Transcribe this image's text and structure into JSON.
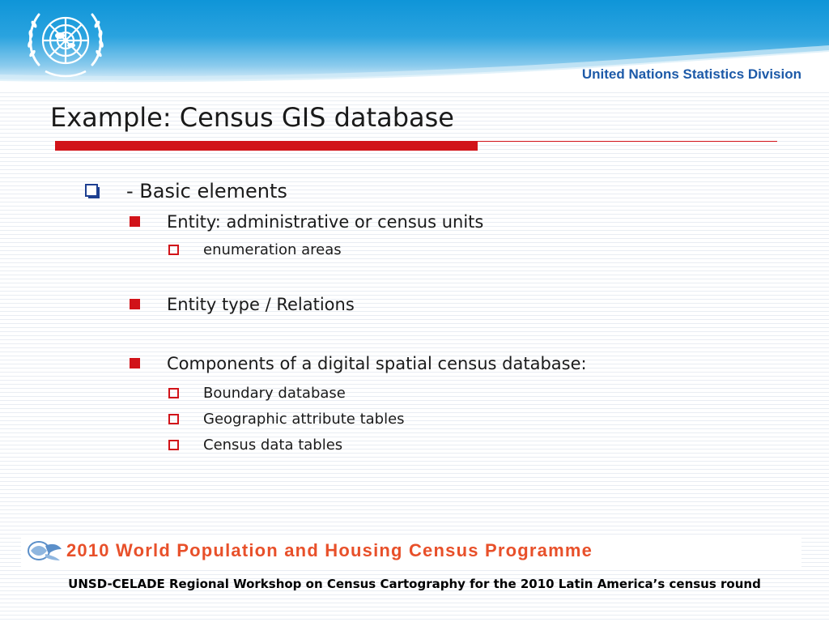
{
  "header": {
    "org_name": "United Nations Statistics Division"
  },
  "slide": {
    "title": "Example: Census GIS database",
    "items": [
      {
        "level": 1,
        "text": "- Basic elements"
      },
      {
        "level": 2,
        "text": "Entity: administrative or census units"
      },
      {
        "level": 3,
        "text": "enumeration areas"
      },
      {
        "level": 2,
        "text": "Entity type / Relations"
      },
      {
        "level": 2,
        "text": "Components of a digital spatial census database:"
      },
      {
        "level": 3,
        "text": "Boundary database"
      },
      {
        "level": 3,
        "text": "Geographic attribute tables"
      },
      {
        "level": 3,
        "text": "Census data tables"
      }
    ]
  },
  "footer": {
    "programme": "2010 World Population and Housing Census Programme",
    "caption": "UNSD-CELADE Regional Workshop on Census Cartography for the 2010 Latin America’s census round"
  },
  "colors": {
    "accent_red": "#d11319",
    "header_blue": "#0f95d8",
    "org_text": "#1d5aa8",
    "programme_orange": "#e8502a"
  },
  "icons": {
    "level1_bullet": "checkbox-shadow-icon",
    "level2_bullet": "filled-square-icon",
    "level3_bullet": "hollow-square-icon",
    "logo": "un-emblem-icon"
  }
}
